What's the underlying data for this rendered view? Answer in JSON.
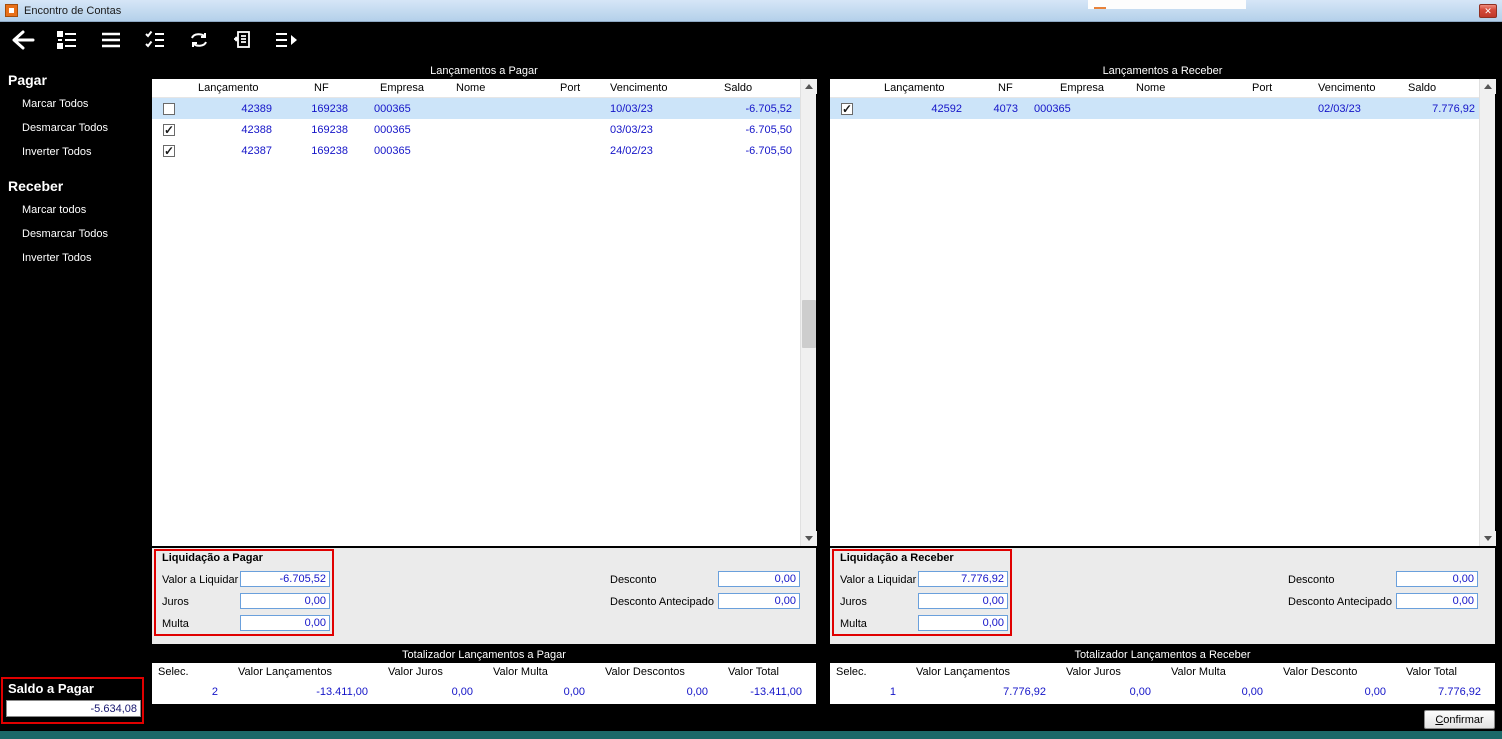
{
  "window": {
    "title": "Encontro de Contas"
  },
  "toolbar": {
    "icons": [
      "back-arrow",
      "mark-all-list",
      "menu-list",
      "checked-list",
      "refresh",
      "copy-document",
      "send-to-list"
    ]
  },
  "sidebar": {
    "pagar": {
      "heading": "Pagar",
      "items": [
        "Marcar Todos",
        "Desmarcar Todos",
        "Inverter Todos"
      ]
    },
    "receber": {
      "heading": "Receber",
      "items": [
        "Marcar todos",
        "Desmarcar Todos",
        "Inverter Todos"
      ]
    },
    "saldo": {
      "label": "Saldo a Pagar",
      "value": "-5.634,08"
    }
  },
  "pagar": {
    "title": "Lançamentos a Pagar",
    "columns": [
      "Lançamento",
      "NF",
      "Empresa",
      "Nome",
      "Port",
      "Vencimento",
      "Saldo"
    ],
    "rows": [
      {
        "checked": false,
        "selected": true,
        "lancamento": "42389",
        "nf": "169238",
        "empresa": "000365",
        "vencimento": "10/03/23",
        "saldo": "-6.705,52"
      },
      {
        "checked": true,
        "selected": false,
        "lancamento": "42388",
        "nf": "169238",
        "empresa": "000365",
        "vencimento": "03/03/23",
        "saldo": "-6.705,50"
      },
      {
        "checked": true,
        "selected": false,
        "lancamento": "42387",
        "nf": "169238",
        "empresa": "000365",
        "vencimento": "24/02/23",
        "saldo": "-6.705,50"
      }
    ],
    "liquidacao": {
      "title": "Liquidação a Pagar",
      "valor_label": "Valor a Liquidar",
      "valor": "-6.705,52",
      "juros_label": "Juros",
      "juros": "0,00",
      "multa_label": "Multa",
      "multa": "0,00",
      "desconto_label": "Desconto",
      "desconto": "0,00",
      "desconto_antecipado_label": "Desconto Antecipado",
      "desconto_antecipado": "0,00"
    },
    "totalizador": {
      "title": "Totalizador Lançamentos a Pagar",
      "columns": [
        "Selec.",
        "Valor Lançamentos",
        "Valor Juros",
        "Valor Multa",
        "Valor Descontos",
        "Valor Total"
      ],
      "values": [
        "2",
        "-13.411,00",
        "0,00",
        "0,00",
        "0,00",
        "-13.411,00"
      ]
    }
  },
  "receber": {
    "title": "Lançamentos a Receber",
    "columns": [
      "Lançamento",
      "NF",
      "Empresa",
      "Nome",
      "Port",
      "Vencimento",
      "Saldo"
    ],
    "rows": [
      {
        "checked": true,
        "selected": true,
        "lancamento": "42592",
        "nf": "4073",
        "empresa": "000365",
        "vencimento": "02/03/23",
        "saldo": "7.776,92"
      }
    ],
    "liquidacao": {
      "title": "Liquidação a Receber",
      "valor_label": "Valor a Liquidar",
      "valor": "7.776,92",
      "juros_label": "Juros",
      "juros": "0,00",
      "multa_label": "Multa",
      "multa": "0,00",
      "desconto_label": "Desconto",
      "desconto": "0,00",
      "desconto_antecipado_label": "Desconto Antecipado",
      "desconto_antecipado": "0,00"
    },
    "totalizador": {
      "title": "Totalizador Lançamentos a Receber",
      "columns": [
        "Selec.",
        "Valor Lançamentos",
        "Valor Juros",
        "Valor Multa",
        "Valor Desconto",
        "Valor Total"
      ],
      "values": [
        "1",
        "7.776,92",
        "0,00",
        "0,00",
        "0,00",
        "7.776,92"
      ]
    }
  },
  "footer": {
    "confirm": "Confirmar"
  }
}
